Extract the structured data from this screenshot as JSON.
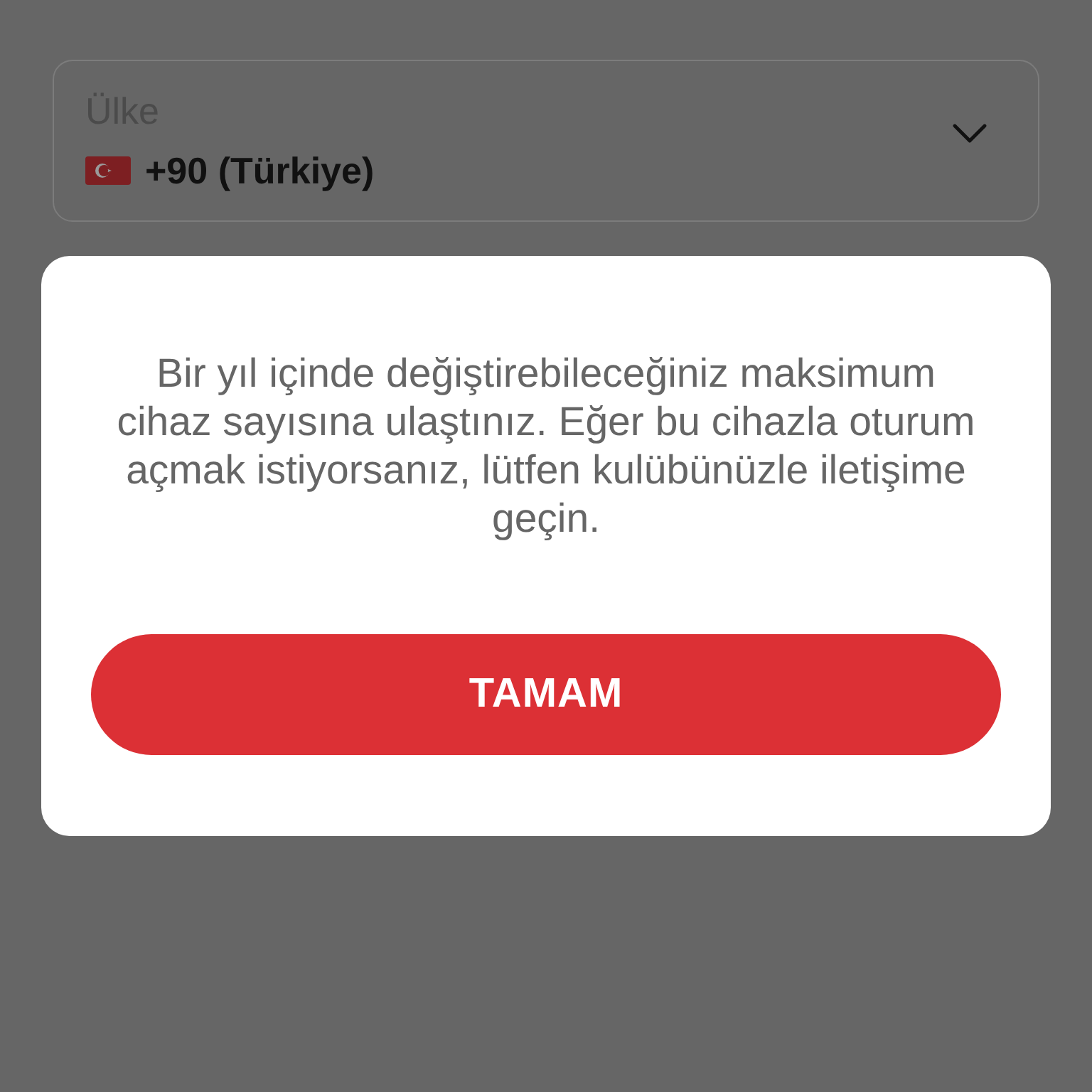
{
  "country_field": {
    "label": "Ülke",
    "value": "+90 (Türkiye)"
  },
  "dialog": {
    "message": "Bir yıl içinde değiştirebileceğiniz maksimum cihaz sayısına ulaştınız. Eğer bu cihazla oturum açmak istiyorsanız, lütfen kulübünüzle iletişime geçin.",
    "button": "TAMAM"
  }
}
